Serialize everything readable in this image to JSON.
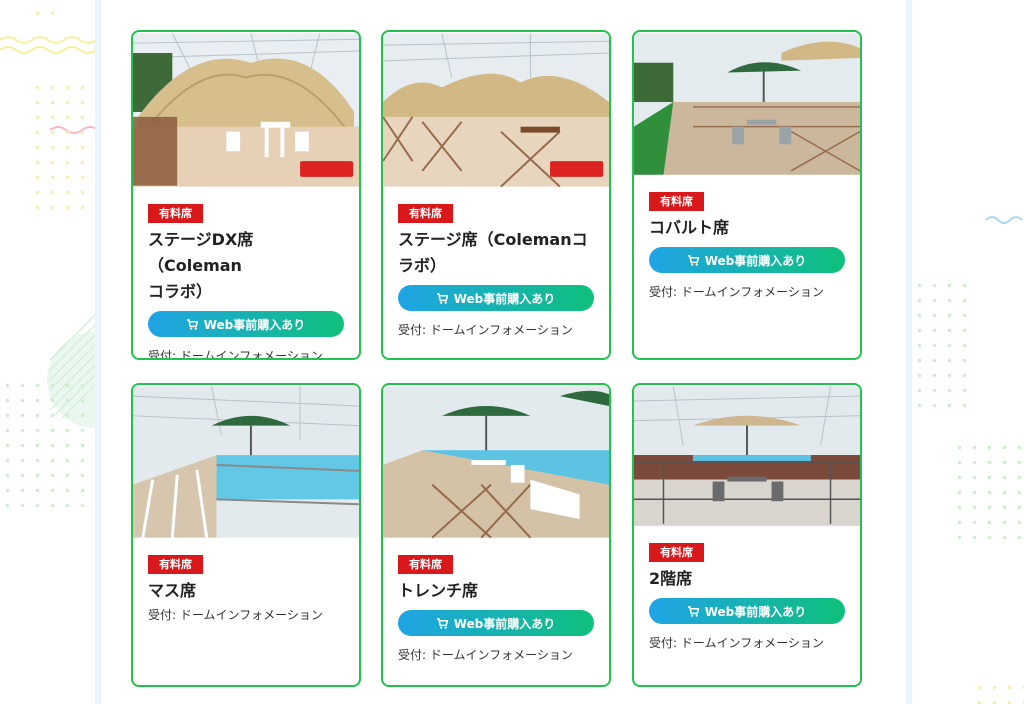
{
  "cards": [
    {
      "badge": "有料席",
      "title": "ステージDX席（Coleman\nコラボ）",
      "has_web": true,
      "web_label": "Web事前購入あり",
      "reception": "受付: ドームインフォメーション",
      "brand": "Coleman"
    },
    {
      "badge": "有料席",
      "title": "ステージ席（Colemanコ\nラボ）",
      "has_web": true,
      "web_label": "Web事前購入あり",
      "reception": "受付: ドームインフォメーション",
      "brand": "Coleman"
    },
    {
      "badge": "有料席",
      "title": "コバルト席",
      "has_web": true,
      "web_label": "Web事前購入あり",
      "reception": "受付: ドームインフォメーション"
    },
    {
      "badge": "有料席",
      "title": "マス席",
      "has_web": false,
      "reception": "受付: ドームインフォメーション"
    },
    {
      "badge": "有料席",
      "title": "トレンチ席",
      "has_web": true,
      "web_label": "Web事前購入あり",
      "reception": "受付: ドームインフォメーション"
    },
    {
      "badge": "有料席",
      "title": "2階席",
      "has_web": true,
      "web_label": "Web事前購入あり",
      "reception": "受付: ドームインフォメーション"
    }
  ],
  "colors": {
    "border": "#23c24e",
    "badge": "#d9181c",
    "btn_from": "#1fa4e6",
    "btn_to": "#0fc07c"
  },
  "icons": {
    "cart": "cart-icon"
  }
}
